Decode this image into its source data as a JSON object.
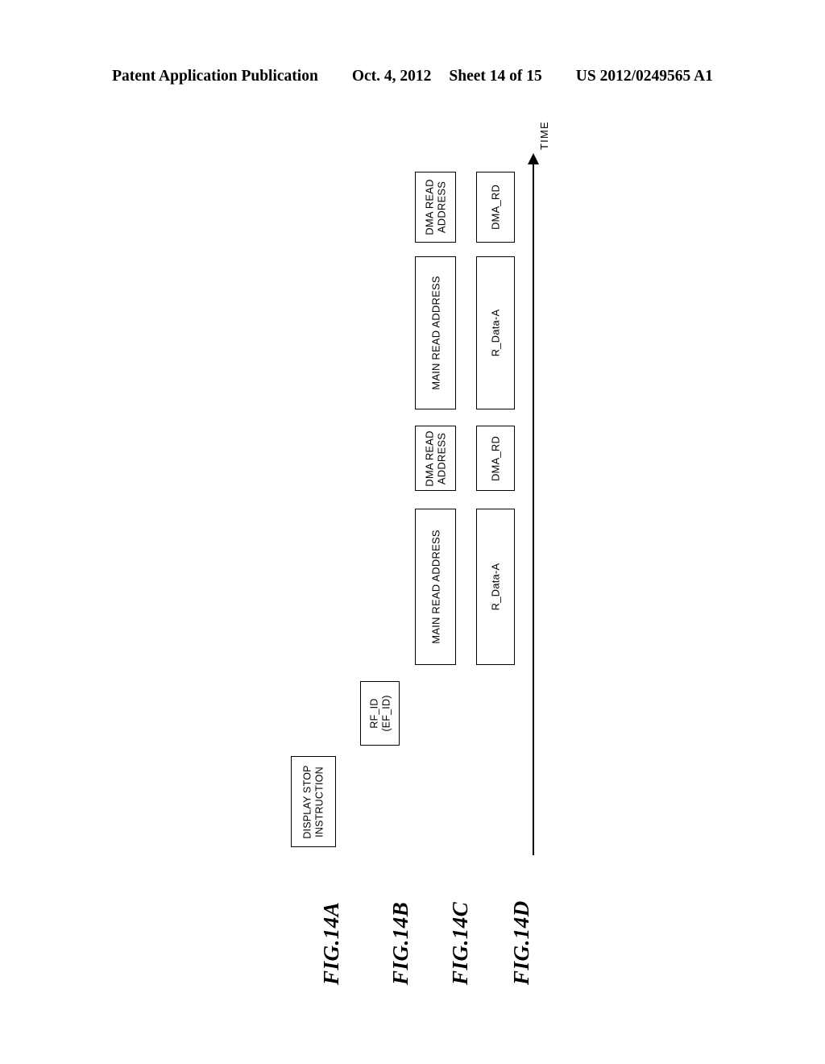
{
  "header": {
    "publication": "Patent Application Publication",
    "date": "Oct. 4, 2012",
    "sheet": "Sheet 14 of 15",
    "patent_number": "US 2012/0249565 A1"
  },
  "figure": {
    "labels": [
      {
        "id": "fig-14a",
        "text": "FIG.14A"
      },
      {
        "id": "fig-14b",
        "text": "FIG.14B"
      },
      {
        "id": "fig-14c",
        "text": "FIG.14C"
      },
      {
        "id": "fig-14d",
        "text": "FIG.14D"
      }
    ],
    "time_axis": {
      "label": "TIME",
      "direction": "upward-in-image (left-to-right in time)"
    },
    "rows": [
      {
        "label": "FIG.14A",
        "boxes": [
          {
            "name": "display-stop-instruction",
            "line1": "DISPLAY STOP",
            "line2": "INSTRUCTION"
          }
        ]
      },
      {
        "label": "FIG.14B",
        "boxes": [
          {
            "name": "rf-id",
            "line1": "RF_ID",
            "line2": "(EF_ID)"
          }
        ]
      },
      {
        "label": "FIG.14C",
        "boxes": [
          {
            "name": "main-read-address-1",
            "line1": "MAIN READ ADDRESS",
            "line2": ""
          },
          {
            "name": "dma-read-address-1",
            "line1": "DMA READ",
            "line2": "ADDRESS"
          },
          {
            "name": "main-read-address-2",
            "line1": "MAIN READ ADDRESS",
            "line2": ""
          },
          {
            "name": "dma-read-address-2",
            "line1": "DMA READ",
            "line2": "ADDRESS"
          }
        ]
      },
      {
        "label": "FIG.14D",
        "boxes": [
          {
            "name": "r-data-a-1",
            "line1": "R_Data-A",
            "line2": ""
          },
          {
            "name": "dma-rd-1",
            "line1": "DMA_RD",
            "line2": ""
          },
          {
            "name": "r-data-a-2",
            "line1": "R_Data-A",
            "line2": ""
          },
          {
            "name": "dma-rd-2",
            "line1": "DMA_RD",
            "line2": ""
          }
        ]
      }
    ]
  }
}
